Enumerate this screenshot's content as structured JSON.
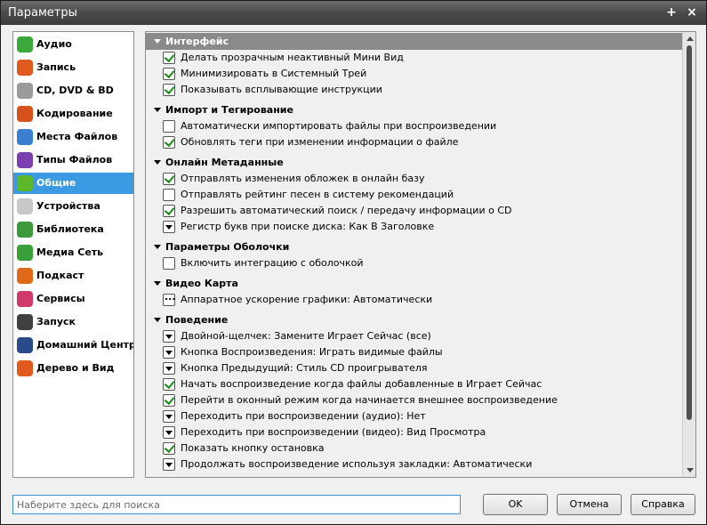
{
  "window": {
    "title": "Параметры",
    "pin_icon": "+",
    "close_icon": "×"
  },
  "sidebar": {
    "items": [
      {
        "label": "Аудио",
        "icon": "audio-icon",
        "color": "#3aa83a"
      },
      {
        "label": "Запись",
        "icon": "record-icon",
        "color": "#e05a1e"
      },
      {
        "label": "CD, DVD & BD",
        "icon": "disc-icon",
        "color": "#9a9a9a"
      },
      {
        "label": "Кодирование",
        "icon": "encode-icon",
        "color": "#d8501c"
      },
      {
        "label": "Места Файлов",
        "icon": "file-locations-icon",
        "color": "#3a7fd0"
      },
      {
        "label": "Типы Файлов",
        "icon": "file-types-icon",
        "color": "#7a3fb0"
      },
      {
        "label": "Общие",
        "icon": "general-icon",
        "color": "#5ab82a",
        "active": true
      },
      {
        "label": "Устройства",
        "icon": "devices-icon",
        "color": "#c8c8c8"
      },
      {
        "label": "Библиотека",
        "icon": "library-icon",
        "color": "#3a9a3a"
      },
      {
        "label": "Медиа Сеть",
        "icon": "media-network-icon",
        "color": "#3aa03a"
      },
      {
        "label": "Подкаст",
        "icon": "podcast-icon",
        "color": "#e06a1a"
      },
      {
        "label": "Сервисы",
        "icon": "services-icon",
        "color": "#d03a6a"
      },
      {
        "label": "Запуск",
        "icon": "startup-icon",
        "color": "#404040"
      },
      {
        "label": "Домашний Центр",
        "icon": "home-center-icon",
        "color": "#2a4a8a"
      },
      {
        "label": "Дерево и Вид",
        "icon": "tree-view-icon",
        "color": "#e05a1e"
      }
    ]
  },
  "groups": [
    {
      "title": "Интерфейс",
      "options": [
        {
          "type": "checked",
          "label": "Делать прозрачным неактивный Мини Вид"
        },
        {
          "type": "checked",
          "label": "Минимизировать в Системный Трей"
        },
        {
          "type": "checked",
          "label": "Показывать всплывающие инструкции"
        }
      ]
    },
    {
      "title": "Импорт и Тегирование",
      "options": [
        {
          "type": "unchecked",
          "label": "Автоматически импортировать файлы при воспроизведении"
        },
        {
          "type": "checked",
          "label": "Обновлять теги при изменении информации о файле"
        }
      ]
    },
    {
      "title": "Онлайн Метаданные",
      "options": [
        {
          "type": "checked",
          "label": "Отправлять изменения обложек в онлайн базу"
        },
        {
          "type": "unchecked",
          "label": "Отправлять рейтинг песен в систему рекомендаций"
        },
        {
          "type": "checked",
          "label": "Разрешить автоматический поиск / передачу информации о CD"
        },
        {
          "type": "dropdown",
          "label": "Регистр букв при поиске диска: Как В Заголовке"
        }
      ]
    },
    {
      "title": "Параметры Оболочки",
      "options": [
        {
          "type": "unchecked",
          "label": "Включить интеграцию с оболочкой"
        }
      ]
    },
    {
      "title": "Видео Карта",
      "options": [
        {
          "type": "dots",
          "label": "Аппаратное ускорение графики: Автоматически"
        }
      ]
    },
    {
      "title": "Поведение",
      "options": [
        {
          "type": "dropdown",
          "label": "Двойной-щелчек: Замените Играет Сейчас (все)"
        },
        {
          "type": "dropdown",
          "label": "Кнопка Воспроизведения: Играть видимые файлы"
        },
        {
          "type": "dropdown",
          "label": "Кнопка Предыдущий: Стиль CD проигрывателя"
        },
        {
          "type": "checked",
          "label": "Начать воспроизведение когда файлы добавленные в Играет Сейчас"
        },
        {
          "type": "checked",
          "label": "Перейти в оконный режим когда начинается внешнее воспроизведение"
        },
        {
          "type": "dropdown",
          "label": "Переходить при воспроизведении (аудио): Нет"
        },
        {
          "type": "dropdown",
          "label": "Переходить при воспроизведении (видео): Вид Просмотра"
        },
        {
          "type": "checked",
          "label": "Показать кнопку остановка"
        },
        {
          "type": "dropdown",
          "label": "Продолжать воспроизведение используя закладки: Автоматически"
        }
      ]
    }
  ],
  "footer": {
    "search_placeholder": "Наберите здесь для поиска",
    "ok_label": "OK",
    "cancel_label": "Отмена",
    "help_label": "Справка"
  }
}
